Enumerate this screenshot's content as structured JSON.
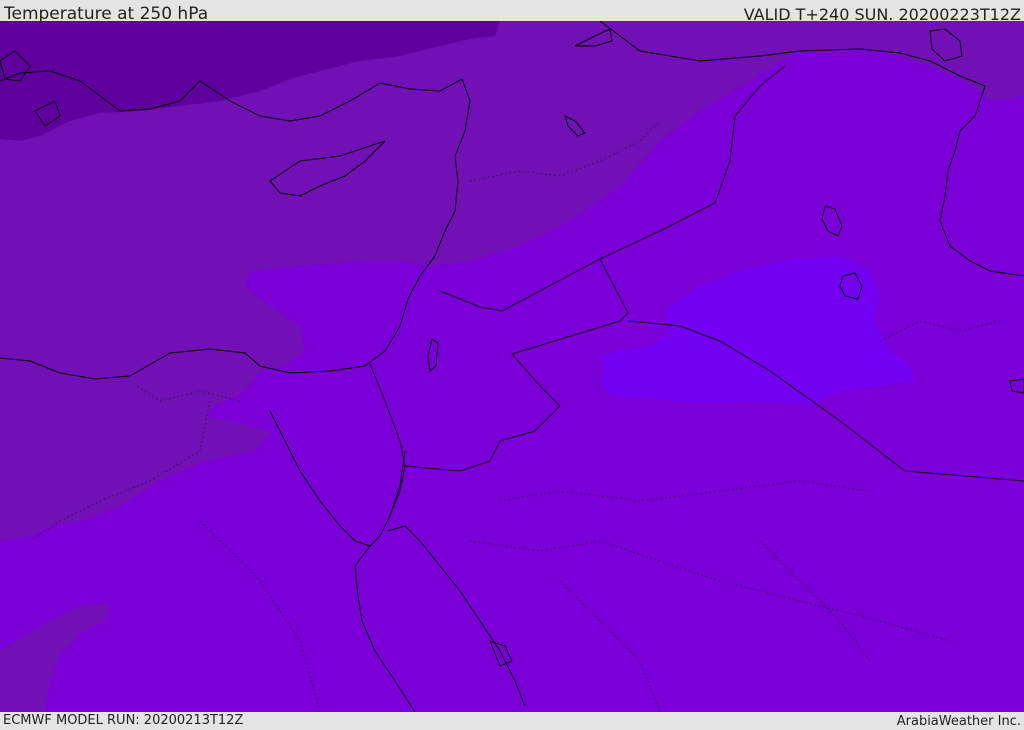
{
  "header": {
    "title": "Temperature at 250 hPa",
    "valid_time": "VALID T+240 SUN. 20200223T12Z"
  },
  "footer": {
    "model_run": "ECMWF MODEL RUN: 20200213T12Z",
    "credit": "ArabiaWeather Inc."
  },
  "map": {
    "field": "temperature",
    "level": "250 hPa",
    "colors": {
      "coldest": "#5f009e",
      "cold": "#7010b5",
      "mid": "#7b00d8",
      "warm": "#7300f0",
      "coast": "#000000",
      "border": "#111111",
      "admin": "#2a1a40"
    }
  }
}
